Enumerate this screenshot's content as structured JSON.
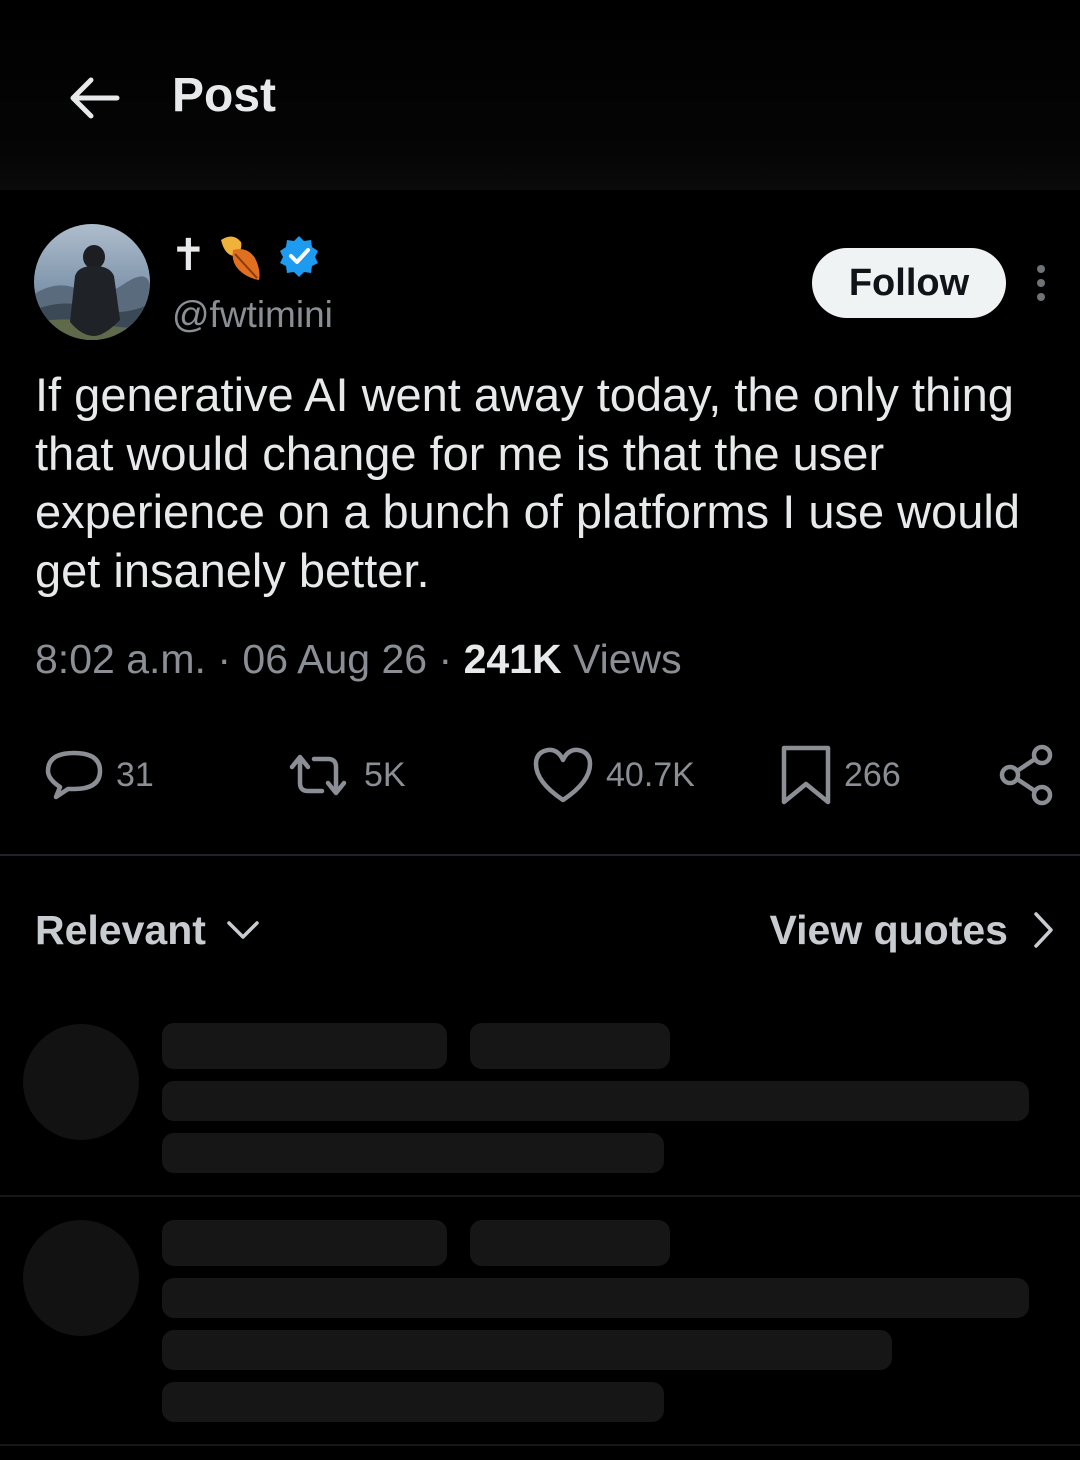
{
  "header": {
    "title": "Post",
    "back_icon": "arrow-left-icon"
  },
  "author": {
    "display_name": "✝",
    "name_emoji_icon": "fallen-leaf-icon",
    "verified_icon": "verified-badge-icon",
    "handle": "@fwtimini",
    "follow_label": "Follow",
    "more_icon": "more-vertical-icon"
  },
  "post": {
    "text": "If generative AI went away today, the only thing that would change for me is that the user experience on a bunch of platforms I use would get insanely better.",
    "time": "8:02 a.m.",
    "date": "06 Aug 26",
    "views_count": "241K",
    "views_label": "Views",
    "separator": "·"
  },
  "actions": {
    "replies": "31",
    "reposts": "5K",
    "likes": "40.7K",
    "bookmarks": "266",
    "icons": [
      "reply-icon",
      "repost-icon",
      "like-icon",
      "bookmark-icon",
      "share-icon"
    ]
  },
  "replies_section": {
    "sort_label": "Relevant",
    "quotes_label": "View quotes"
  },
  "colors": {
    "background": "#000000",
    "text_primary": "#e7e9ea",
    "text_secondary": "#8b8f95",
    "verified_blue": "#1d9bf0",
    "follow_bg": "#eff3f4",
    "skeleton": "#161616"
  }
}
